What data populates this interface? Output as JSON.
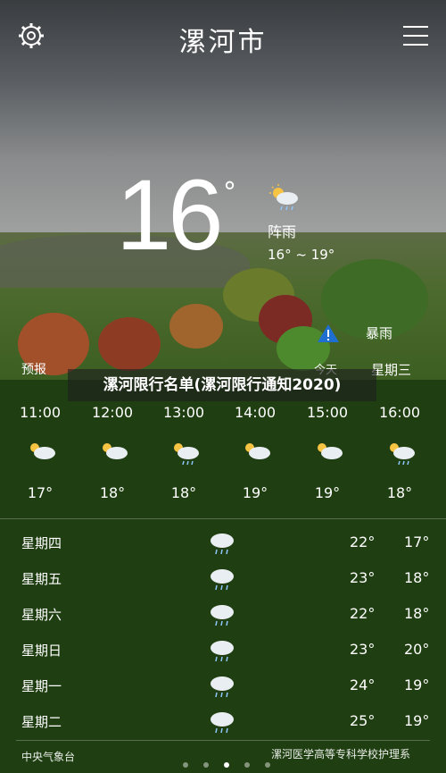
{
  "header": {
    "city": "漯河市",
    "settings_icon": "gear-icon",
    "menu_icon": "menu-icon"
  },
  "current": {
    "temperature": "16",
    "degree": "°",
    "condition": "阵雨",
    "range": "16° ~ 19°",
    "icon": "sun-cloud-rain-icon"
  },
  "alert": {
    "text": "暴雨",
    "icon": "warning-icon"
  },
  "labels": {
    "forecast": "预报",
    "today": "今天",
    "weekday": "星期三"
  },
  "banner": {
    "text": "漯河限行名单(漯河限行通知2020)"
  },
  "hourly": [
    {
      "time": "11:00",
      "temp": "17°",
      "icon": "sun-cloud-icon"
    },
    {
      "time": "12:00",
      "temp": "18°",
      "icon": "sun-cloud-icon"
    },
    {
      "time": "13:00",
      "temp": "18°",
      "icon": "sun-cloud-rain-icon"
    },
    {
      "time": "14:00",
      "temp": "19°",
      "icon": "sun-cloud-icon"
    },
    {
      "time": "15:00",
      "temp": "19°",
      "icon": "sun-cloud-icon"
    },
    {
      "time": "16:00",
      "temp": "18°",
      "icon": "sun-cloud-rain-icon"
    }
  ],
  "daily": [
    {
      "day": "星期四",
      "hi": "22°",
      "lo": "17°",
      "icon": "cloud-rain-icon"
    },
    {
      "day": "星期五",
      "hi": "23°",
      "lo": "18°",
      "icon": "cloud-rain-icon"
    },
    {
      "day": "星期六",
      "hi": "22°",
      "lo": "18°",
      "icon": "cloud-rain-icon"
    },
    {
      "day": "星期日",
      "hi": "23°",
      "lo": "20°",
      "icon": "cloud-rain-icon"
    },
    {
      "day": "星期一",
      "hi": "24°",
      "lo": "19°",
      "icon": "cloud-rain-icon"
    },
    {
      "day": "星期二",
      "hi": "25°",
      "lo": "19°",
      "icon": "cloud-rain-icon"
    }
  ],
  "footer": {
    "source": "中央气象台",
    "page_dots": 5,
    "active_dot": 2,
    "watermark": "漯河医学高等专科学校护理系"
  }
}
